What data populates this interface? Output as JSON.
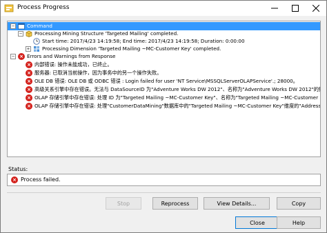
{
  "window": {
    "title": "Process Progress"
  },
  "tree": {
    "items": [
      {
        "expander": "−",
        "icon": "command-icon",
        "text": "Command",
        "selected": true
      },
      {
        "expander": "−",
        "icon": "process-cube-icon",
        "text": "Processing Mining Structure 'Targeted Mailing' completed."
      },
      {
        "icon": "clock-icon",
        "text": "Start time: 2017/4/23 14:19:58; End time: 2017/4/23 14:19:58; Duration: 0:00:00"
      },
      {
        "expander": "+",
        "icon": "process-dimension-icon",
        "text": "Processing Dimension 'Targeted Mailing ~MC-Customer Key' completed."
      },
      {
        "expander": "−",
        "icon": "error-icon",
        "text": "Errors and Warnings from Response"
      },
      {
        "icon": "error-icon",
        "text": "内部错误: 操作未能成功，已终止。"
      },
      {
        "icon": "error-icon",
        "text": "服务器: 已取消当前操作，因为事务中的另一个操作失败。"
      },
      {
        "icon": "error-icon",
        "text": "OLE DB 错误: OLE DB 或 ODBC 错误 : Login failed for user 'NT Service\\MSSQLServerOLAPService'.; 28000。"
      },
      {
        "icon": "error-icon",
        "text": "高级关系引擎中存在错误。无法与 DataSourceID 为\"Adventure Works DW 2012\"、名称为\"Adventure Works DW 2012\"的数据源建立连接。"
      },
      {
        "icon": "error-icon",
        "text": "OLAP 存储引擎中存在错误: 处理 ID 为\"Targeted Mailing ~MC-Customer Key\"、名称为\"Targeted Mailing ~MC-Customer Key\"的维度时出错。"
      },
      {
        "icon": "error-icon",
        "text": "OLAP 存储引擎中存在错误: 处理\"CustomerDataMining\"数据库中的\"Targeted Mailing ~MC-Customer Key\"维度的\"Address Line1\"属性时出错。"
      }
    ]
  },
  "status": {
    "label": "Status:",
    "icon": "error-icon",
    "text": "Process failed."
  },
  "buttons": {
    "stop": "Stop",
    "reprocess": "Reprocess",
    "view_details": "View Details...",
    "copy": "Copy",
    "close": "Close",
    "help": "Help"
  },
  "colors": {
    "selection": "#3399ff",
    "error": "#d4211c",
    "default_button_border": "#0078d7"
  }
}
